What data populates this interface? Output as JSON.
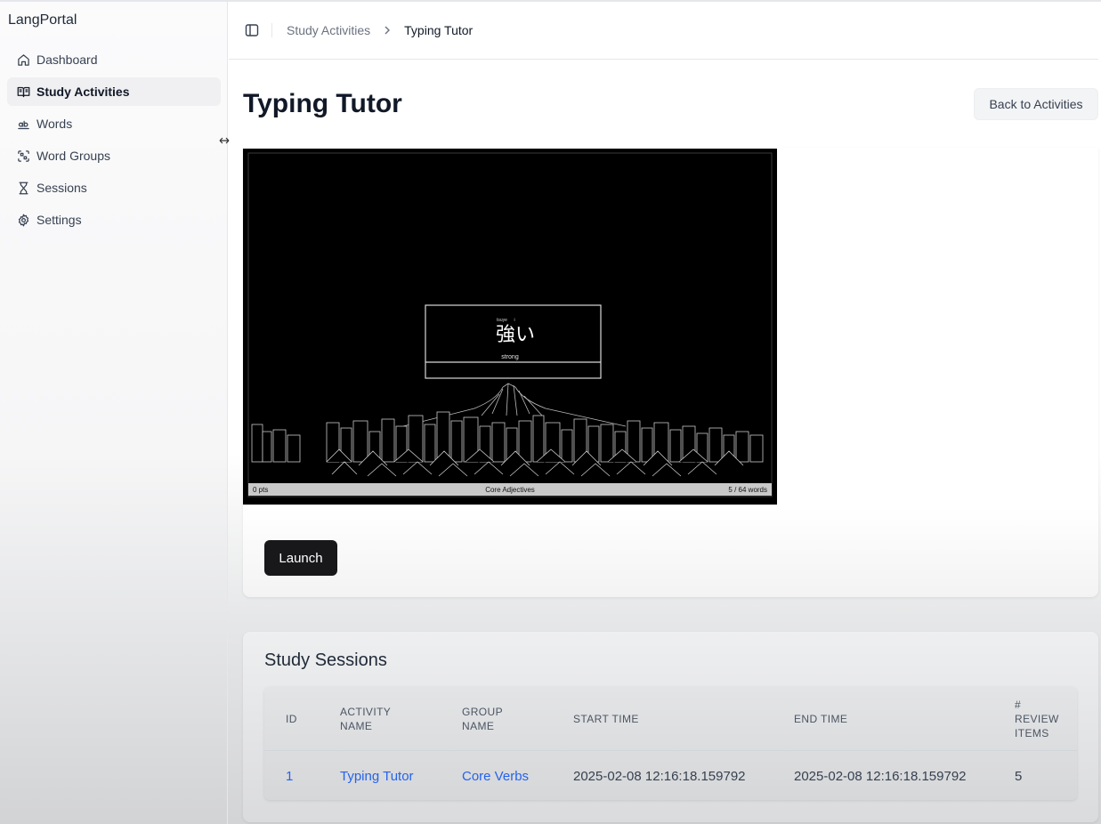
{
  "app": {
    "title": "LangPortal"
  },
  "sidebar": {
    "items": [
      {
        "label": "Dashboard",
        "icon": "home-icon",
        "active": false
      },
      {
        "label": "Study Activities",
        "icon": "book-open-icon",
        "active": true
      },
      {
        "label": "Words",
        "icon": "words-icon",
        "active": false
      },
      {
        "label": "Word Groups",
        "icon": "word-groups-icon",
        "active": false
      },
      {
        "label": "Sessions",
        "icon": "hourglass-icon",
        "active": false
      },
      {
        "label": "Settings",
        "icon": "gear-icon",
        "active": false
      }
    ]
  },
  "header": {
    "breadcrumb": {
      "parent": "Study Activities",
      "current": "Typing Tutor"
    }
  },
  "main": {
    "title": "Typing Tutor",
    "back_button": "Back to Activities",
    "launch_button": "Launch"
  },
  "preview": {
    "reading_parts": [
      "tsuye",
      "i"
    ],
    "word": "強い",
    "meaning": "strong",
    "score": "0 pts",
    "group": "Core Adjectives",
    "progress": "5 / 64 words"
  },
  "sessions": {
    "title": "Study Sessions",
    "columns": {
      "id": "ID",
      "activity_l1": "ACTIVITY",
      "activity_l2": "NAME",
      "group_l1": "GROUP",
      "group_l2": "NAME",
      "start": "START TIME",
      "end": "END TIME",
      "review_l1": "#",
      "review_l2": "REVIEW",
      "review_l3": "ITEMS"
    },
    "rows": [
      {
        "id": "1",
        "activity": "Typing Tutor",
        "group": "Core Verbs",
        "start": "2025-02-08 12:16:18.159792",
        "end": "2025-02-08 12:16:18.159792",
        "review_items": "5"
      }
    ]
  },
  "colors": {
    "primary_button": "#18181b",
    "link": "#2563eb",
    "preview_background": "#000000"
  }
}
